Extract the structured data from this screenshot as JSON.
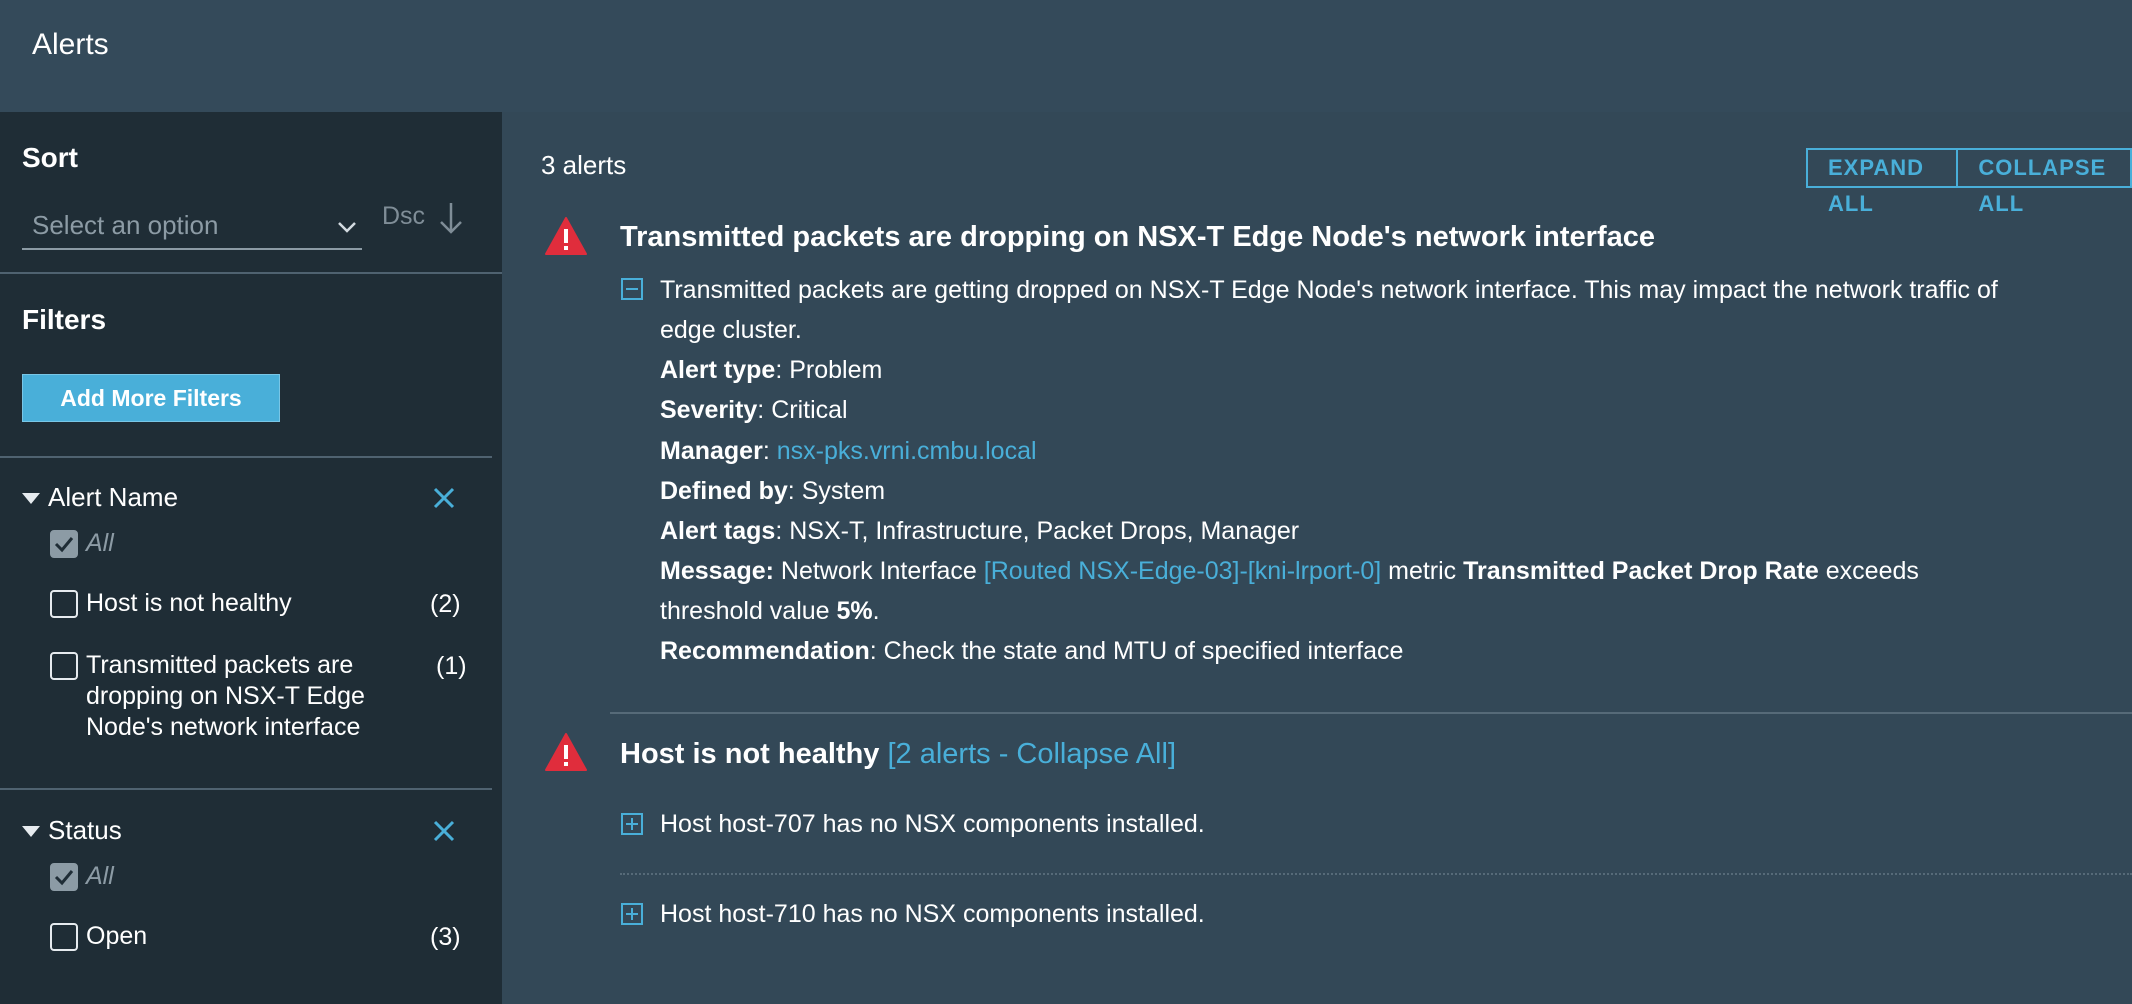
{
  "header": {
    "title": "Alerts"
  },
  "sidebar": {
    "sort": {
      "title": "Sort",
      "select_placeholder": "Select an option",
      "direction_label": "Dsc"
    },
    "filters": {
      "title": "Filters",
      "add_button": "Add More Filters"
    },
    "groups": [
      {
        "title": "Alert Name",
        "all_label": "All",
        "options": [
          {
            "label": "Host is not healthy",
            "count": "(2)"
          },
          {
            "label": "Transmitted packets are dropping on NSX-T Edge Node's network interface",
            "count": "(1)"
          }
        ]
      },
      {
        "title": "Status",
        "all_label": "All",
        "options": [
          {
            "label": "Open",
            "count": "(3)"
          }
        ]
      }
    ]
  },
  "main": {
    "count_label": "3 alerts",
    "expand_all": "EXPAND ALL",
    "collapse_all": "COLLAPSE ALL",
    "alert1": {
      "title": "Transmitted packets are dropping on NSX-T Edge Node's network interface",
      "description_line1": "Transmitted packets are getting dropped on NSX-T Edge Node's network interface. This may impact the network traffic of",
      "description_line2": "edge cluster.",
      "alert_type_label": "Alert type",
      "alert_type": "Problem",
      "severity_label": "Severity",
      "severity": "Critical",
      "manager_label": "Manager",
      "manager": "nsx-pks.vrni.cmbu.local",
      "defined_by_label": "Defined by",
      "defined_by": "System",
      "tags_label": "Alert tags",
      "tags": "NSX-T, Infrastructure, Packet Drops, Manager",
      "message_label": "Message:",
      "message_prefix": "Network Interface",
      "message_link": "[Routed NSX-Edge-03]-[kni-lrport-0]",
      "message_metric_word": "metric",
      "message_metric": "Transmitted Packet Drop Rate",
      "message_exceeds": "exceeds",
      "message_threshold_prefix": "threshold value",
      "message_threshold": "5%",
      "recommendation_label": "Recommendation",
      "recommendation": "Check the state and MTU of specified interface"
    },
    "alert2": {
      "title": "Host is not healthy",
      "group_link": "[2 alerts - Collapse All]",
      "items": [
        "Host host-707 has no NSX components installed.",
        "Host host-710 has no NSX components installed."
      ]
    }
  },
  "colors": {
    "accent": "#49afd9",
    "critical": "#e02d3c",
    "sidebar_bg": "#1f2d36",
    "main_bg": "#334857"
  }
}
